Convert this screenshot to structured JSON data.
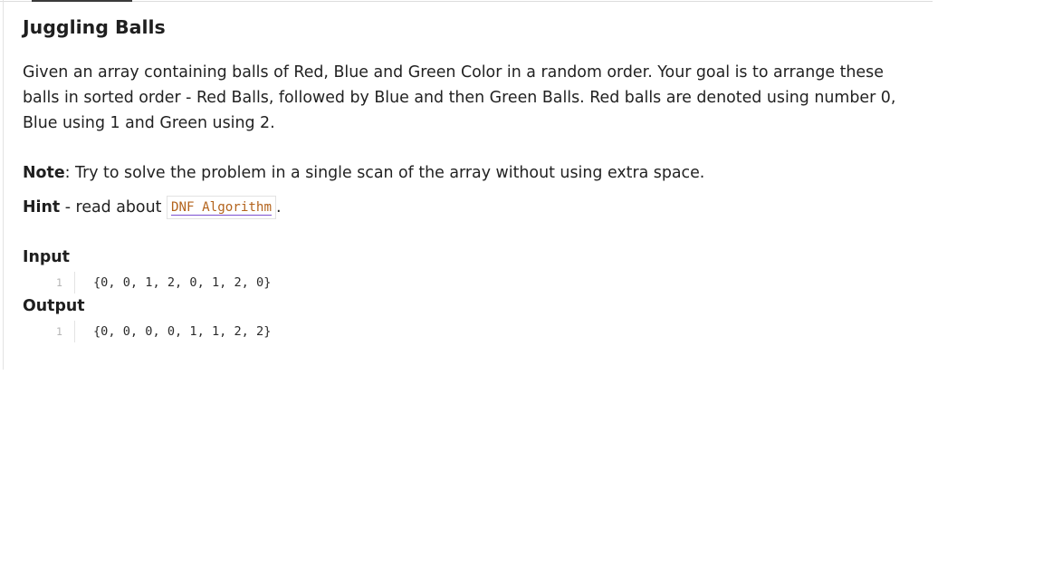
{
  "problem": {
    "title": "Juggling Balls",
    "description": "Given an array containing balls of Red, Blue and Green Color in a random order. Your goal is to arrange these balls in sorted order - Red Balls, followed by Blue and then Green Balls. Red balls are denoted using number 0, Blue using 1 and Green using 2.",
    "note_label": "Note",
    "note_text": ": Try to solve the problem in a single scan of the array without using extra space.",
    "hint_label": "Hint",
    "hint_text": " - read about ",
    "hint_link": "DNF Algorithm",
    "hint_suffix": "."
  },
  "input": {
    "label": "Input",
    "line_number": "1",
    "code": "{0, 0, 1, 2, 0, 1, 2, 0}"
  },
  "output": {
    "label": "Output",
    "line_number": "1",
    "code": "{0, 0, 0, 0, 1, 1, 2, 2}"
  },
  "colors": {
    "link_text": "#b3631c",
    "link_underline": "#7b4fd1",
    "text": "#222222"
  }
}
